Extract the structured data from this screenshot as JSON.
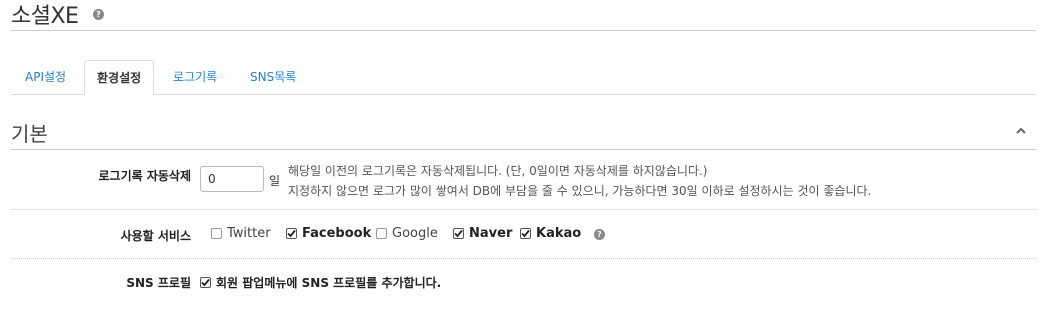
{
  "header": {
    "title": "소셜XE",
    "help_glyph": "?"
  },
  "tabs": [
    {
      "label": "API설정",
      "active": false
    },
    {
      "label": "환경설정",
      "active": true
    },
    {
      "label": "로그기록",
      "active": false
    },
    {
      "label": "SNS목록",
      "active": false
    }
  ],
  "section": {
    "title": "기본"
  },
  "log_autodelete": {
    "label": "로그기록 자동삭제",
    "value": "0",
    "unit": "일",
    "desc_line1": "해당일 이전의 로그기록은 자동삭제됩니다. (단, 0일이면 자동삭제를 하지않습니다.)",
    "desc_line2": "지정하지 않으면 로그가 많이 쌓여서 DB에 부담을 줄 수 있으니, 가능하다면 30일 이하로 설정하시는 것이 좋습니다."
  },
  "services": {
    "label": "사용할 서비스",
    "items": [
      {
        "label": "Twitter",
        "checked": false
      },
      {
        "label": "Facebook",
        "checked": true
      },
      {
        "label": "Google",
        "checked": false
      },
      {
        "label": "Naver",
        "checked": true
      },
      {
        "label": "Kakao",
        "checked": true
      }
    ],
    "help_glyph": "?"
  },
  "sns_profile": {
    "label": "SNS 프로필",
    "option_label": "회원 팝업메뉴에 SNS 프로필를 추가합니다.",
    "checked": true
  },
  "colors": {
    "link": "#2a7fc1",
    "text": "#333333",
    "border": "#cccccc"
  },
  "icons": {
    "help": "question-circle-icon",
    "collapse": "chevron-up-icon",
    "check": "checkmark-icon"
  }
}
